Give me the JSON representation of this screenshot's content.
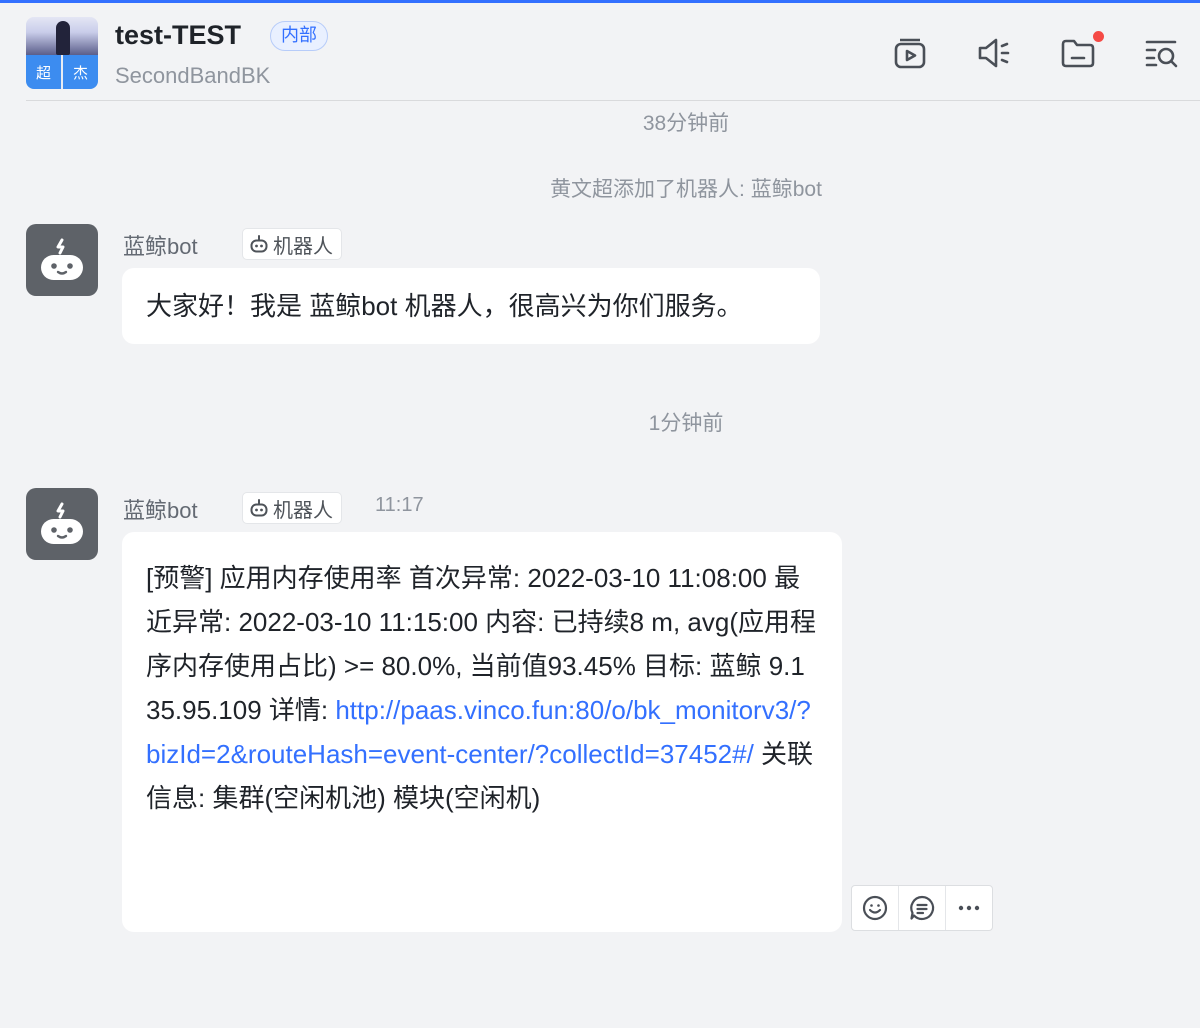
{
  "header": {
    "title": "test-TEST",
    "tag": "内部",
    "subtitle": "SecondBandBK",
    "avatar_chars": [
      "超",
      "杰"
    ],
    "icons": [
      "video-window-icon",
      "announcement-icon",
      "folder-icon",
      "search-history-icon"
    ]
  },
  "system": {
    "time1": "38分钟前",
    "event": "黄文超添加了机器人: 蓝鲸bot",
    "time2": "1分钟前"
  },
  "messages": [
    {
      "sender": "蓝鲸bot",
      "tag": "机器人",
      "text": "大家好！我是 蓝鲸bot 机器人，很高兴为你们服务。"
    },
    {
      "sender": "蓝鲸bot",
      "tag": "机器人",
      "time": "11:17",
      "text_before": "[预警] 应用内存使用率 首次异常: 2022-03-10 11:08:00 最近异常: 2022-03-10 11:15:00 内容: 已持续8 m, avg(应用程序内存使用占比) >= 80.0%, 当前值93.45% 目标: 蓝鲸 9.135.95.109 详情: ",
      "link": "http://paas.vinco.fun:80/o/bk_monitorv3/?bizId=2&routeHash=event-center/?collectId=37452#/",
      "text_after": " 关联信息: 集群(空闲机池) 模块(空闲机)"
    }
  ],
  "colors": {
    "background": "#f2f3f5",
    "accent": "#3370ff",
    "notify": "#f54a45",
    "bot_avatar": "#5e6268"
  }
}
